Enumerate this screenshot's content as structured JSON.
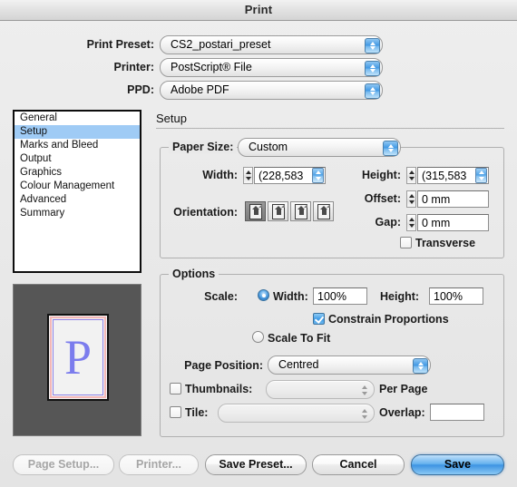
{
  "window": {
    "title": "Print"
  },
  "header": {
    "rows": [
      {
        "label": "Print Preset:",
        "value": "CS2_postari_preset",
        "icon": "chevron-updown-icon"
      },
      {
        "label": "Printer:",
        "value": "PostScript® File",
        "icon": "chevron-updown-icon"
      },
      {
        "label": "PPD:",
        "value": "Adobe PDF",
        "icon": "chevron-updown-icon"
      }
    ]
  },
  "sidebar": {
    "items": [
      {
        "label": "General",
        "selected": false
      },
      {
        "label": "Setup",
        "selected": true
      },
      {
        "label": "Marks and Bleed",
        "selected": false
      },
      {
        "label": "Output",
        "selected": false
      },
      {
        "label": "Graphics",
        "selected": false
      },
      {
        "label": "Colour Management",
        "selected": false
      },
      {
        "label": "Advanced",
        "selected": false
      },
      {
        "label": "Summary",
        "selected": false
      }
    ]
  },
  "preview": {
    "page_letter": "P",
    "background_color": "#565656",
    "page_color": "#f2f2f2",
    "bleed_color": "#f4b7b7",
    "margin_color": "#8f84e8",
    "letter_color": "#7b7ced"
  },
  "panel": {
    "heading": "Setup",
    "paper_size": {
      "legend": "Paper Size:",
      "preset": {
        "value": "Custom",
        "icon": "chevron-updown-icon"
      },
      "width": {
        "label": "Width:",
        "value": "(228,583",
        "stepper_icon": "stepper-icon",
        "blue_stepper_icon": "stepper-icon"
      },
      "height": {
        "label": "Height:",
        "value": "(315,583",
        "stepper_icon": "stepper-icon",
        "blue_stepper_icon": "stepper-icon"
      },
      "offset": {
        "label": "Offset:",
        "value": "0 mm",
        "stepper_icon": "stepper-icon"
      },
      "gap": {
        "label": "Gap:",
        "value": "0 mm",
        "stepper_icon": "stepper-icon"
      },
      "transverse": {
        "label": "Transverse",
        "checked": false
      },
      "orientation": {
        "label": "Orientation:",
        "buttons": [
          {
            "name": "portrait",
            "selected": true
          },
          {
            "name": "landscape",
            "selected": false
          },
          {
            "name": "portrait-flipped",
            "selected": false
          },
          {
            "name": "landscape-flipped",
            "selected": false
          }
        ]
      }
    },
    "options": {
      "legend": "Options",
      "scale": {
        "label": "Scale:",
        "radio_selected": true,
        "width_label": "Width:",
        "width_value": "100%",
        "height_label": "Height:",
        "height_value": "100%"
      },
      "constrain": {
        "label": "Constrain Proportions",
        "checked": true
      },
      "scale_to_fit": {
        "label": "Scale To Fit",
        "selected": false
      },
      "page_position": {
        "label": "Page Position:",
        "value": "Centred",
        "icon": "chevron-updown-icon"
      },
      "thumbnails": {
        "label": "Thumbnails:",
        "checked": false,
        "value": "",
        "suffix": "Per Page",
        "icon": "stepper-icon"
      },
      "tile": {
        "label": "Tile:",
        "checked": false,
        "value": "",
        "overlap_label": "Overlap:",
        "overlap_value": "",
        "icon": "stepper-icon"
      }
    }
  },
  "footer": {
    "buttons": [
      {
        "label": "Page Setup...",
        "state": "disabled"
      },
      {
        "label": "Printer...",
        "state": "disabled"
      },
      {
        "label": "Save Preset...",
        "state": "normal"
      },
      {
        "label": "Cancel",
        "state": "normal"
      },
      {
        "label": "Save",
        "state": "default"
      }
    ]
  }
}
